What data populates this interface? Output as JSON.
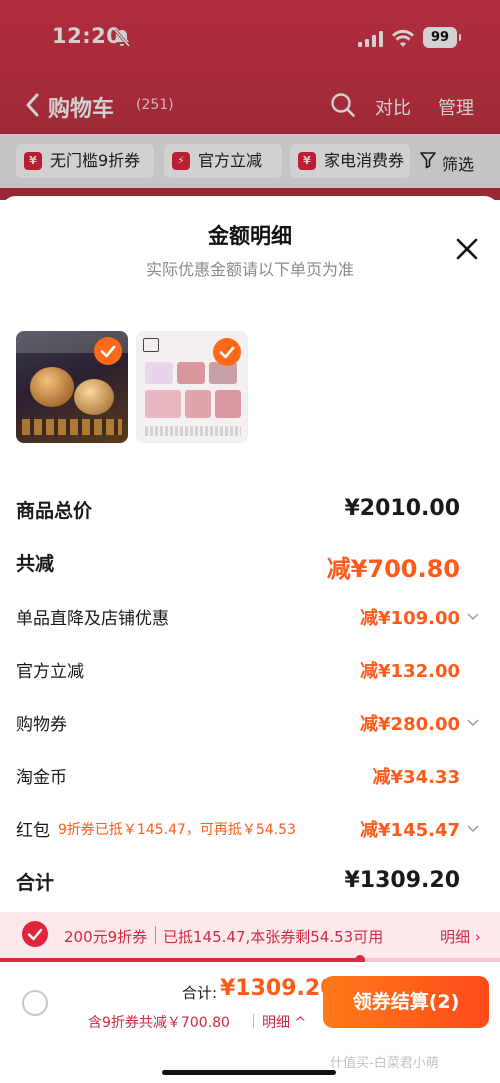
{
  "status_bar": {
    "time": "12:20",
    "battery": "99"
  },
  "nav": {
    "title": "购物车",
    "count": "(251)",
    "compare": "对比",
    "manage": "管理"
  },
  "chips": [
    {
      "label": "无门槛9折券",
      "icon": "coupon-icon"
    },
    {
      "label": "官方立减",
      "icon": "lightning-icon"
    },
    {
      "label": "家电消费券",
      "icon": "coupon-icon"
    }
  ],
  "filter_label": "筛选",
  "sheet": {
    "title": "金额明细",
    "subtitle": "实际优惠金额请以下单页为准"
  },
  "rows": [
    {
      "label": "商品总价",
      "value": "¥2010.00"
    },
    {
      "label": "共减",
      "value": "减¥700.80"
    },
    {
      "label": "单品直降及店铺优惠",
      "value": "减¥109.00"
    },
    {
      "label": "官方立减",
      "value": "减¥132.00"
    },
    {
      "label": "购物券",
      "value": "减¥280.00"
    },
    {
      "label": "淘金币",
      "value": "减¥34.33"
    },
    {
      "label": "红包",
      "note": "9折券已抵￥145.47，可再抵￥54.53",
      "value": "减¥145.47"
    },
    {
      "label": "合计",
      "value": "¥1309.20"
    }
  ],
  "coupon_bar": {
    "name": "200元9折券",
    "desc": "已抵145.47,本张券剩54.53可用",
    "detail": "明细 ›",
    "progress": 0.72
  },
  "bottom": {
    "total_label": "合计:",
    "total_value": "¥1309.20",
    "save_text": "含9折券共减￥700.80",
    "save_detail": "明细 ^",
    "checkout_label": "领券结算(2)"
  },
  "watermark": "什值买-白菜君小萌",
  "colors": {
    "accent": "#ff5a1a",
    "brand_red": "#e0263c",
    "header": "#c9343f"
  }
}
